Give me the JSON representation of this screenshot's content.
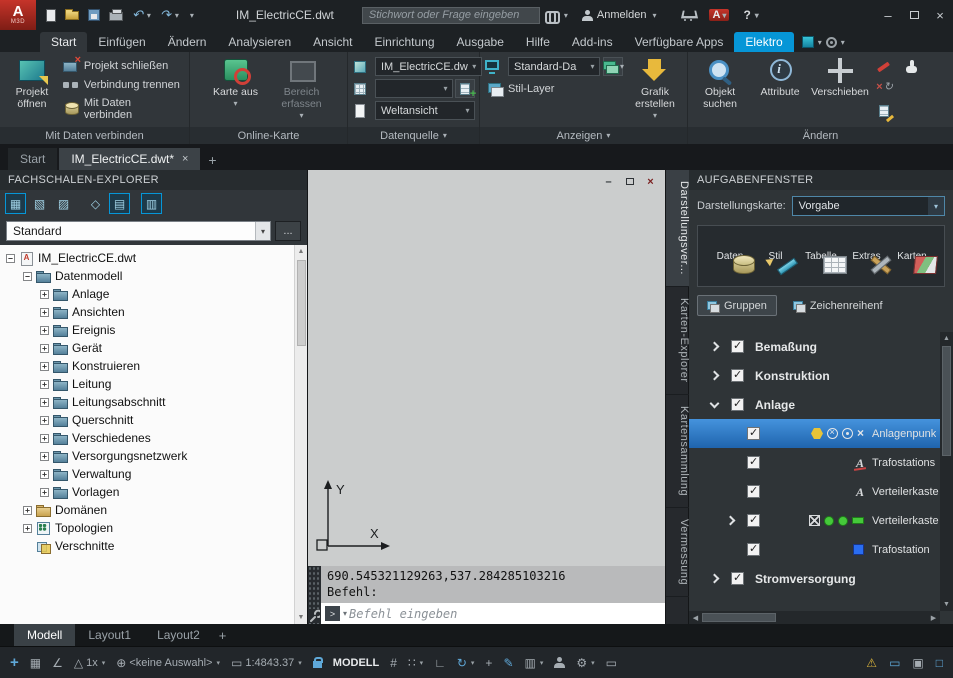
{
  "icons": {
    "plus": "+",
    "minimize": "–",
    "close": "×",
    "tab_close": "×"
  },
  "titlebar": {
    "title": "IM_ElectricCE.dwt",
    "search_placeholder": "Stichwort oder Frage eingeben",
    "signin_label": "Anmelden",
    "help_label": "?"
  },
  "ribbon": {
    "tabs": [
      {
        "label": "Start",
        "active": true
      },
      {
        "label": "Einfügen"
      },
      {
        "label": "Ändern"
      },
      {
        "label": "Analysieren"
      },
      {
        "label": "Ansicht"
      },
      {
        "label": "Einrichtung"
      },
      {
        "label": "Ausgabe"
      },
      {
        "label": "Hilfe"
      },
      {
        "label": "Add-ins"
      },
      {
        "label": "Verfügbare Apps"
      },
      {
        "label": "Elektro",
        "highlight": true
      }
    ],
    "panels": {
      "p1": {
        "title": "Mit Daten verbinden",
        "big": "Projekt öffnen",
        "rows": [
          "Projekt schließen",
          "Verbindung trennen",
          "Mit Daten verbinden"
        ]
      },
      "p2": {
        "title": "Online-Karte",
        "b1": "Karte aus",
        "b2": "Bereich erfassen"
      },
      "p3": {
        "title": "Datenquelle",
        "c1": "IM_ElectricCE.dw",
        "c3": "Weltansicht"
      },
      "p4": {
        "title": "Anzeigen",
        "combo": "Standard-Da",
        "stil": "Stil-Layer",
        "big": "Grafik erstellen"
      },
      "p5": {
        "title": "Ändern",
        "b1": "Objekt suchen",
        "b2": "Attribute",
        "b3": "Verschieben"
      }
    }
  },
  "filetabs": {
    "start": "Start",
    "active": "IM_ElectricCE.dwt*"
  },
  "explorer": {
    "title": "FACHSCHALEN-EXPLORER",
    "combo_value": "Standard",
    "more_label": "...",
    "toolbar": [
      {
        "name": "display-model-icon",
        "glyph": "▦",
        "selected": true,
        "group": 0
      },
      {
        "name": "display-map-icon",
        "glyph": "▧",
        "selected": false,
        "group": 0
      },
      {
        "name": "display-library-icon",
        "glyph": "▨",
        "selected": false,
        "group": 0
      },
      {
        "name": "compass-icon",
        "glyph": "◇",
        "selected": false,
        "group": 1
      },
      {
        "name": "grid-view-icon",
        "glyph": "▤",
        "selected": true,
        "group": 1
      },
      {
        "name": "detail-view-icon",
        "glyph": "▥",
        "selected": true,
        "group": 2
      }
    ],
    "tree": [
      {
        "label": "IM_ElectricCE.dwt",
        "level": 0,
        "exp": "minus",
        "icon": "dwg"
      },
      {
        "label": "Datenmodell",
        "level": 1,
        "exp": "minus",
        "icon": "folder"
      },
      {
        "label": "Anlage",
        "level": 2,
        "exp": "plus",
        "icon": "folder"
      },
      {
        "label": "Ansichten",
        "level": 2,
        "exp": "plus",
        "icon": "folder"
      },
      {
        "label": "Ereignis",
        "level": 2,
        "exp": "plus",
        "icon": "folder"
      },
      {
        "label": "Gerät",
        "level": 2,
        "exp": "plus",
        "icon": "folder"
      },
      {
        "label": "Konstruieren",
        "level": 2,
        "exp": "plus",
        "icon": "folder"
      },
      {
        "label": "Leitung",
        "level": 2,
        "exp": "plus",
        "icon": "folder"
      },
      {
        "label": "Leitungsabschnitt",
        "level": 2,
        "exp": "plus",
        "icon": "folder"
      },
      {
        "label": "Querschnitt",
        "level": 2,
        "exp": "plus",
        "icon": "folder"
      },
      {
        "label": "Verschiedenes",
        "level": 2,
        "exp": "plus",
        "icon": "folder"
      },
      {
        "label": "Versorgungsnetzwerk",
        "level": 2,
        "exp": "plus",
        "icon": "folder"
      },
      {
        "label": "Verwaltung",
        "level": 2,
        "exp": "plus",
        "icon": "folder"
      },
      {
        "label": "Vorlagen",
        "level": 2,
        "exp": "plus",
        "icon": "folder"
      },
      {
        "label": "Domänen",
        "level": 1,
        "exp": "plus",
        "icon": "domain"
      },
      {
        "label": "Topologien",
        "level": 1,
        "exp": "plus",
        "icon": "topology"
      },
      {
        "label": "Verschnitte",
        "level": 1,
        "exp": "none",
        "icon": "overlay"
      }
    ]
  },
  "canvas": {
    "coords_line": "690.545321129263,537.284285103216",
    "prompt_line": "Befehl:",
    "input_placeholder": "Befehl eingeben",
    "axis_x": "X",
    "axis_y": "Y"
  },
  "side_tabs": [
    {
      "label": "Darstellungsver...",
      "active": true
    },
    {
      "label": "Karten-Explorer"
    },
    {
      "label": "Kartensammlung"
    },
    {
      "label": "Vermessung"
    }
  ],
  "taskpane": {
    "title": "AUFGABENFENSTER",
    "display_label": "Darstellungskarte:",
    "display_value": "Vorgabe",
    "toolbar": [
      {
        "name": "daten",
        "label": "Daten"
      },
      {
        "name": "stil",
        "label": "Stil"
      },
      {
        "name": "tabelle",
        "label": "Tabelle"
      },
      {
        "name": "extras",
        "label": "Extras"
      },
      {
        "name": "karten",
        "label": "Karten"
      }
    ],
    "tabs": [
      {
        "label": "Gruppen",
        "active": true
      },
      {
        "label": "Zeichenreihenf"
      }
    ],
    "rows": [
      {
        "type": "group",
        "label": "Bemaßung",
        "chevron": "right",
        "checked": true
      },
      {
        "type": "group",
        "label": "Konstruktion",
        "chevron": "right",
        "checked": true
      },
      {
        "type": "group",
        "label": "Anlage",
        "chevron": "down",
        "checked": true
      },
      {
        "type": "layer",
        "label": "Anlagenpunk",
        "checked": true,
        "selected": true,
        "icons": [
          "hexagon",
          "circle-x",
          "circle-dot",
          "x-mark"
        ]
      },
      {
        "type": "layer",
        "label": "Trafostations",
        "checked": true,
        "icons": [
          "letter-a-tools"
        ]
      },
      {
        "type": "layer",
        "label": "Verteilerkaste",
        "checked": true,
        "icons": [
          "letter-a"
        ]
      },
      {
        "type": "layer",
        "label": "Verteilerkaste",
        "checked": true,
        "chevron": "right",
        "icons": [
          "box-x",
          "dot-green",
          "dot-green",
          "bar-green"
        ]
      },
      {
        "type": "layer",
        "label": "Trafostation",
        "checked": true,
        "icons": [
          "square-blue"
        ]
      },
      {
        "type": "group",
        "label": "Stromversorgung",
        "chevron": "right",
        "checked": true
      }
    ]
  },
  "layout_tabs": [
    {
      "label": "Modell",
      "active": true
    },
    {
      "label": "Layout1"
    },
    {
      "label": "Layout2"
    }
  ],
  "statusbar": {
    "left": [
      {
        "name": "autotrack-icon",
        "glyph": "+",
        "cls": "blue big"
      },
      {
        "name": "infer-constraints-icon",
        "glyph": "▦",
        "cls": ""
      },
      {
        "name": "polar-tracking-icon",
        "glyph": "∠",
        "cls": ""
      },
      {
        "name": "selection-cycling",
        "glyph": "△",
        "label": "1x",
        "dd": true
      },
      {
        "name": "geo-location",
        "glyph": "⊕",
        "label": "<keine Auswahl>",
        "dd": true
      },
      {
        "name": "annotation-scale",
        "glyph": "▭",
        "label": "1:4843.37",
        "dd": true
      },
      {
        "name": "scale-lock-icon",
        "css": "ic-lock",
        "cls": "blue"
      },
      {
        "name": "model-space-label",
        "label": "MODELL",
        "cls": "white"
      },
      {
        "name": "grid-display-icon",
        "glyph": "#",
        "cls": ""
      },
      {
        "name": "snap-mode-icon",
        "glyph": "∷",
        "dd": true
      },
      {
        "name": "ortho-mode-icon",
        "glyph": "∟",
        "cls": ""
      },
      {
        "name": "object-snap-icon",
        "glyph": "↻",
        "dd": true,
        "cls": "blue"
      },
      {
        "name": "crosshair-icon",
        "glyph": "+",
        "cls": ""
      },
      {
        "name": "annotation-icon",
        "glyph": "✎",
        "cls": "blue"
      },
      {
        "name": "workspace-icon",
        "glyph": "▥",
        "dd": true,
        "cls": ""
      },
      {
        "name": "user-icon",
        "css": "ic-person2",
        "cls": ""
      },
      {
        "name": "customization-icon",
        "glyph": "⚙",
        "dd": true,
        "cls": ""
      },
      {
        "name": "isolate-objects-icon",
        "glyph": "▭",
        "cls": ""
      }
    ],
    "right": [
      {
        "name": "performance-warning-icon",
        "glyph": "⚠",
        "cls": "warn"
      },
      {
        "name": "hardware-accel-icon",
        "glyph": "▭",
        "cls": "blue"
      },
      {
        "name": "clean-screen-icon",
        "glyph": "▣",
        "cls": ""
      },
      {
        "name": "fullscreen-icon",
        "glyph": "□",
        "cls": "blue"
      }
    ]
  }
}
